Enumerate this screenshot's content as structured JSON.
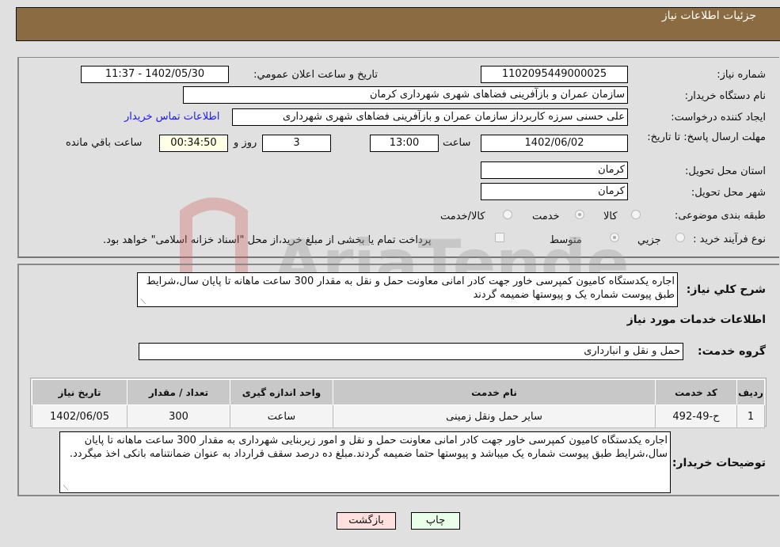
{
  "header": {
    "title": "جزئیات اطلاعات نیاز"
  },
  "form": {
    "need_number": {
      "label": "شماره نیاز:",
      "value": "1102095449000025"
    },
    "announce_datetime": {
      "label": "تاریخ و ساعت اعلان عمومي:",
      "value": "1402/05/30 - 11:37"
    },
    "buyer_org": {
      "label": "نام دستگاه خریدار:",
      "value": "سازمان عمران و بازآفرینی فضاهای شهری شهرداری کرمان"
    },
    "creator": {
      "label": "ایجاد کننده درخواست:",
      "value": "علی حسنی سرزه کاربرداز سازمان عمران و بازآفرینی فضاهای شهری شهرداری",
      "contact_link": "اطلاعات تماس خریدار"
    },
    "deadline": {
      "label": "مهلت ارسال پاسخ: تا تاریخ:",
      "date": "1402/06/02",
      "time_label": "ساعت",
      "time": "13:00",
      "days": "3",
      "days_label": "روز و",
      "remaining": "00:34:50",
      "remaining_label": "ساعت باقي مانده"
    },
    "province": {
      "label": "استان محل تحویل:",
      "value": "کرمان"
    },
    "city": {
      "label": "شهر محل تحویل:",
      "value": "کرمان"
    },
    "category": {
      "label": "طبقه بندی موضوعی:",
      "options": [
        {
          "label": "کالا",
          "checked": false
        },
        {
          "label": "خدمت",
          "checked": true
        },
        {
          "label": "کالا/خدمت",
          "checked": false
        }
      ]
    },
    "purchase_type": {
      "label": "نوع فرآیند خرید :",
      "options": [
        {
          "label": "جزيي",
          "checked": false
        },
        {
          "label": "متوسط",
          "checked": true
        }
      ],
      "treasury_note": "پرداخت تمام یا بخشی از مبلغ خرید،از محل \"اسناد خزانه اسلامی\" خواهد بود."
    }
  },
  "details": {
    "general_desc_label": "شرح کلي نیاز:",
    "general_desc": "اجاره یکدستگاه کامیون کمپرسی خاور جهت کادر امانی معاونت حمل و نقل به مقدار 300 ساعت ماهانه تا پایان سال،شرایط طبق پیوست شماره یک و پیوستها ضمیمه گردند",
    "services_heading": "اطلاعات خدمات مورد نیاز",
    "service_group_label": "گروه خدمت:",
    "service_group": "حمل و نقل و انبارداری",
    "table": {
      "headers": [
        "ردیف",
        "کد خدمت",
        "نام خدمت",
        "واحد اندازه گیری",
        "تعداد / مقدار",
        "تاریخ نیاز"
      ],
      "rows": [
        [
          "1",
          "ح-49-492",
          "سایر حمل ونقل زمینی",
          "ساعت",
          "300",
          "1402/06/05"
        ]
      ]
    },
    "buyer_notes_label": "توضیحات خریدار:",
    "buyer_notes": "اجاره یکدستگاه کامیون کمپرسی خاور جهت کادر امانی معاونت حمل و نقل و امور زیربنایی شهرداری به مقدار 300 ساعت ماهانه تا پایان سال،شرایط طبق پیوست شماره یک میباشد و پیوستها حتما ضمیمه گردند.مبلغ ده درصد سقف قرارداد به عنوان ضمانتنامه بانکی اخذ میگردد."
  },
  "buttons": {
    "print": "چاپ",
    "back": "بازگشت"
  },
  "watermark": {
    "text": "AriaTender.neT"
  },
  "colors": {
    "header_bg": "#8b6b42",
    "print_bg": "#eaffea",
    "back_bg": "#ffe0e0",
    "link": "#1a1aff",
    "remaining_bg": "#ffffe6"
  }
}
